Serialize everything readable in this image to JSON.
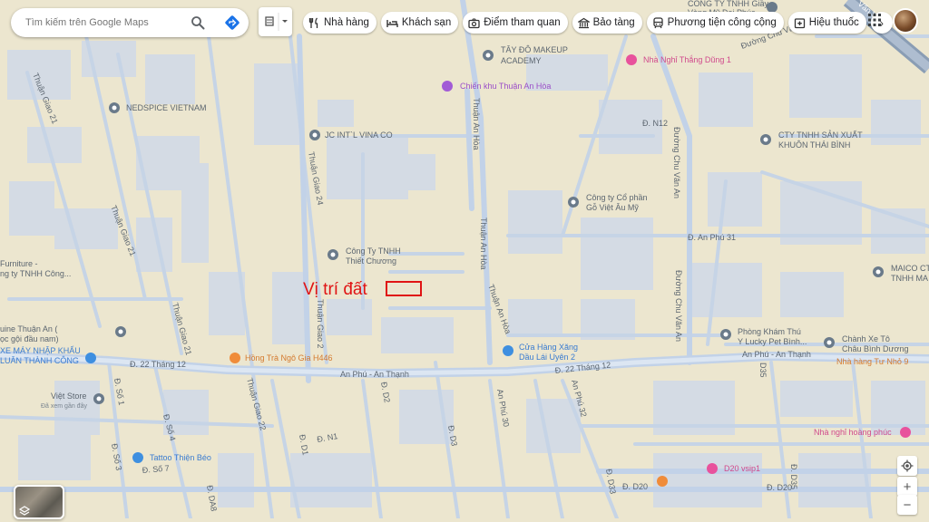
{
  "search": {
    "placeholder": "Tìm kiếm trên Google Maps"
  },
  "chips": [
    {
      "label": "Nhà hàng",
      "icon": "restaurant-icon"
    },
    {
      "label": "Khách sạn",
      "icon": "hotel-icon"
    },
    {
      "label": "Điểm tham quan",
      "icon": "camera-icon"
    },
    {
      "label": "Bảo tàng",
      "icon": "museum-icon"
    },
    {
      "label": "Phương tiện công cộng",
      "icon": "transit-icon"
    },
    {
      "label": "Hiệu thuốc",
      "icon": "pharmacy-icon"
    }
  ],
  "annotation": {
    "label": "Vị trí đất"
  },
  "streets": {
    "thuan_giao_21": "Thuận Giao 21",
    "thuan_an_hoa": "Thuận An Hòa",
    "thuan_giao_24": "Thuận Giao 24",
    "thuan_giao_2": "Thuận Giao 2",
    "thuan_giao_22": "Thuận Giao 22",
    "d_22_thang_12": "Đ. 22 Tháng 12",
    "an_phu_an_thanh": "An Phú - An Thạnh",
    "d_n12": "Đ. N12",
    "duong_chu_van_an": "Đường Chu Văn An",
    "d_an_phu_31": "Đ. An Phú 31",
    "an_phu_30": "An Phú 30",
    "an_phu_32": "An Phú 32",
    "d_d2": "Đ. D2",
    "d_d3": "Đ. D3",
    "d_n1": "Đ. N1",
    "d_d1": "Đ. D1",
    "d_so_1": "Đ. Số 1",
    "d_so_3": "Đ. Số 3",
    "d_so_4": "Đ. Số 4",
    "d_so_7": "Đ. Số 7",
    "d_da8": "Đ. DA8",
    "d_d33": "Đ. D33",
    "d_d20": "Đ. D20",
    "d_d20_b": "Đ. D20",
    "d35": "D35",
    "d_d35": "Đ. D35",
    "van_vo": "Văn Vô"
  },
  "places": {
    "tay_do_makeup_1": "TÂY ĐÔ MAKEUP",
    "tay_do_makeup_2": "ACADEMY",
    "nha_nghi_thang_dung": "Nhà Nghỉ Thắng Dũng 1",
    "chien_khu": "Chiến khu Thuận An Hòa",
    "nedspice": "NEDSPICE VIETNAM",
    "jc_intl": "JC INT`L VINA CO",
    "cty_san_xuat_1": "CTY TNHH SẢN XUẤT",
    "cty_san_xuat_2": "KHUÔN THÁI BÌNH",
    "cty_go_1": "Công ty Cổ phần",
    "cty_go_2": "Gỗ Việt Âu Mỹ",
    "cty_thiet_chuong_1": "Công Ty TNHH",
    "cty_thiet_chuong_2": "Thiết Chương",
    "furniture_1": "Furniture -",
    "furniture_2": "ng ty TNHH Công...",
    "maico_1": "MAICO CT",
    "maico_2": "TNHH MA",
    "thuan_an_1": "uine Thuận An (",
    "thuan_an_2": "ọc gội đầu nam)",
    "xe_may_1": "XE MÁY NHẬP KHẨU",
    "xe_may_2": "LUÂN THÀNH CÔNG",
    "hong_tra": "Hồng Trà Ngô Gia H446",
    "cua_hang_xang_1": "Cửa Hàng Xăng",
    "cua_hang_xang_2": "Dầu Lái Uyên 2",
    "phong_kham_1": "Phòng Khám Thú",
    "phong_kham_2": "Y Lucky Pet Bình...",
    "chanh_xe_1": "Chành Xe Tô",
    "chanh_xe_2": "Châu Bình Dương",
    "nha_hang_tu_nho": "Nhà hàng Tư Nhỏ 9",
    "viet_store": "Việt Store",
    "viet_store_sub": "Đã xem gần đây",
    "tattoo": "Tattoo Thiện Béo",
    "nha_nghi_hoang_phuc": "Nhà nghỉ hoàng phúc",
    "d20_vsip1": "D20 vsip1",
    "cty_giay_1": "CÔNG TY TNHH Giầy",
    "cty_giay_2": "Vàng Mỹ Đại Phúc"
  },
  "controls": {
    "zoom_in": "+",
    "zoom_out": "−"
  },
  "colors": {
    "land": "#ece6cf",
    "land_alt": "#e6e0c8",
    "building": "#d4dbe4",
    "building_dark": "#c8d0da",
    "road": "#ffffff",
    "road_major": "#c2d2e8",
    "poi_gray": "#6a7a8a",
    "poi_pink": "#e8529c",
    "poi_purple": "#a25bd6",
    "poi_orange": "#f08c3a",
    "poi_blue": "#3e8fe0",
    "marker_red": "#e01414"
  }
}
